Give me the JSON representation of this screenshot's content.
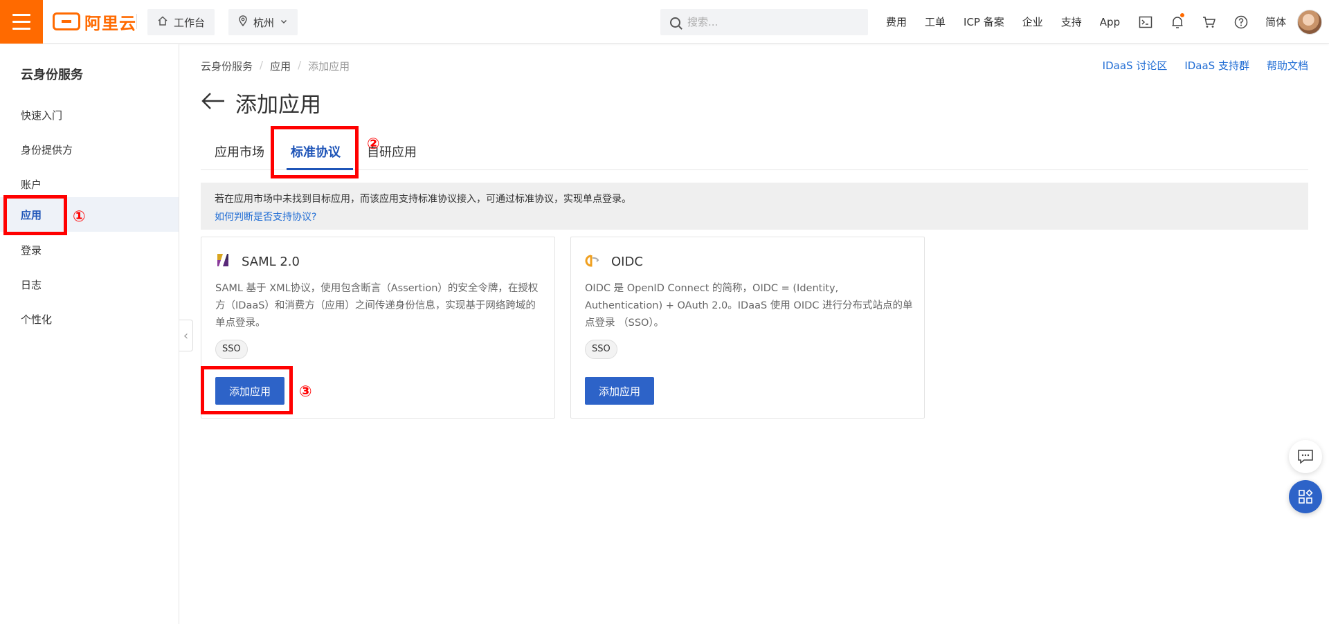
{
  "header": {
    "logo_text": "阿里云",
    "workbench_label": "工作台",
    "region_label": "杭州",
    "search_placeholder": "搜索...",
    "nav": [
      "费用",
      "工单",
      "ICP 备案",
      "企业",
      "支持",
      "App"
    ],
    "lang_label": "简体",
    "icons": [
      "home-icon",
      "location-icon",
      "chevron-down-icon",
      "search-icon",
      "terminal-icon",
      "bell-icon",
      "cart-icon",
      "help-icon"
    ]
  },
  "sidebar": {
    "title": "云身份服务",
    "items": [
      {
        "label": "快速入门"
      },
      {
        "label": "身份提供方"
      },
      {
        "label": "账户"
      },
      {
        "label": "应用"
      },
      {
        "label": "登录"
      },
      {
        "label": "日志"
      },
      {
        "label": "个性化"
      }
    ],
    "active_item": "应用"
  },
  "breadcrumb": [
    "云身份服务",
    "应用",
    "添加应用"
  ],
  "help_links": [
    "IDaaS 讨论区",
    "IDaaS 支持群",
    "帮助文档"
  ],
  "page": {
    "title": "添加应用",
    "tabs": [
      "应用市场",
      "标准协议",
      "自研应用"
    ],
    "active_tab": "标准协议"
  },
  "notice": {
    "text": "若在应用市场中未找到目标应用，而该应用支持标准协议接入，可通过标准协议，实现单点登录。",
    "link": "如何判断是否支持协议?"
  },
  "cards": [
    {
      "name": "SAML 2.0",
      "description": "SAML 基于 XML协议，使用包含断言（Assertion）的安全令牌，在授权方（IDaaS）和消费方（应用）之间传递身份信息，实现基于网络跨域的单点登录。",
      "tag": "SSO",
      "button": "添加应用"
    },
    {
      "name": "OIDC",
      "description": "OIDC 是 OpenID Connect 的简称，OIDC = (Identity, Authentication) + OAuth 2.0。IDaaS 使用 OIDC 进行分布式站点的单点登录 （SSO）。",
      "tag": "SSO",
      "button": "添加应用"
    }
  ],
  "annotations": [
    "①",
    "②",
    "③"
  ],
  "colors": {
    "brand": "#ff6a00",
    "primary": "#2d63c8",
    "link": "#1f6cd4",
    "annotation": "#ff0000"
  }
}
